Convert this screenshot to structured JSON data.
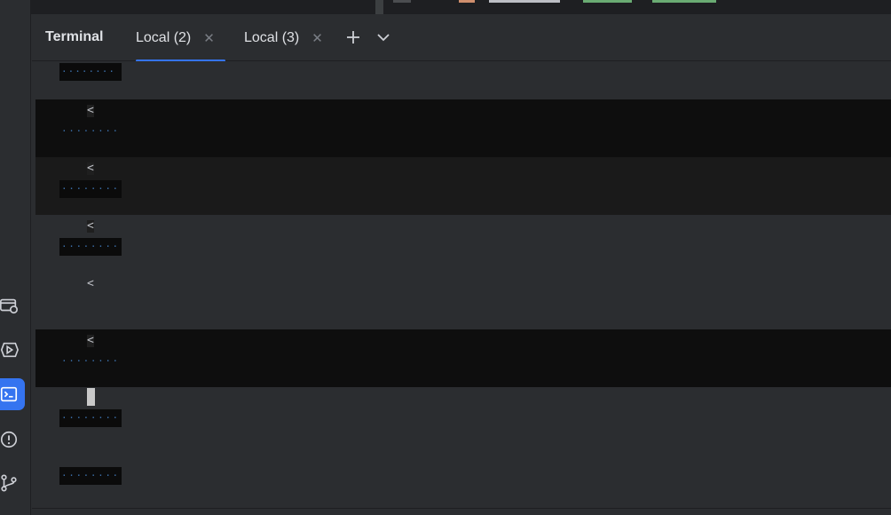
{
  "terminal": {
    "title": "Terminal",
    "tabs": [
      {
        "label": "Local (2)",
        "selected": true
      },
      {
        "label": "Local (3)",
        "selected": false
      }
    ],
    "prompt_glyph": "<",
    "dots": "········"
  },
  "toolbar_icons": [
    "services-icon",
    "run-icon",
    "terminal-icon",
    "problems-icon",
    "git-icon"
  ],
  "colors": {
    "accent": "#3574f0",
    "background": "#2b2d30",
    "prompt_dark": "#0e0e0e",
    "prompt_mid": "#1a1a1a"
  }
}
